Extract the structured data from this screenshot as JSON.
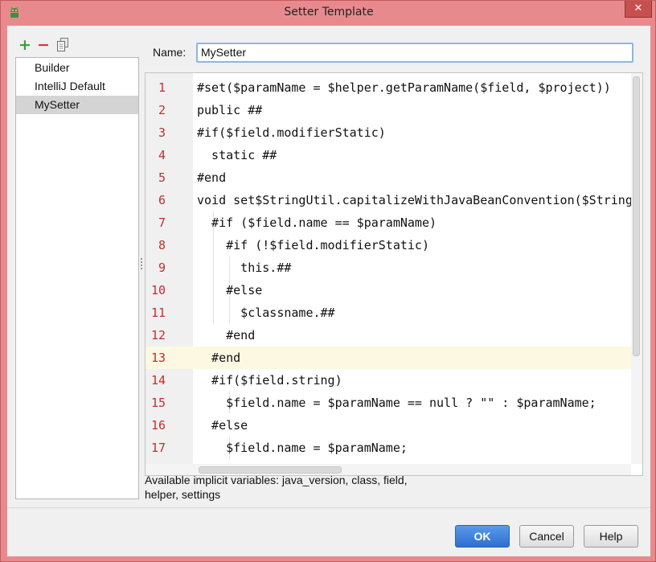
{
  "window": {
    "title": "Setter Template",
    "close_glyph": "✕"
  },
  "toolbar": {
    "add_icon": "plus-icon",
    "remove_icon": "minus-icon",
    "copy_icon": "copy-icon",
    "add_glyph": "+",
    "remove_glyph": "−"
  },
  "templates": {
    "items": [
      {
        "label": "Builder"
      },
      {
        "label": "IntelliJ Default"
      },
      {
        "label": "MySetter"
      }
    ],
    "selected": "MySetter"
  },
  "name_field": {
    "label": "Name:",
    "value": "MySetter"
  },
  "editor": {
    "current_line": 13,
    "lines": [
      {
        "num": "1",
        "text": "#set($paramName = $helper.getParamName($field, $project))"
      },
      {
        "num": "2",
        "text": "public ##"
      },
      {
        "num": "3",
        "text": "#if($field.modifierStatic)"
      },
      {
        "num": "4",
        "text": "  static ##"
      },
      {
        "num": "5",
        "text": "#end"
      },
      {
        "num": "6",
        "text": "void set$StringUtil.capitalizeWithJavaBeanConvention($StringUtil.sanitizeJavaIdentifier($helper.getPropertyName($field, $project)))($field.type $paramName) {"
      },
      {
        "num": "7",
        "text": "  #if ($field.name == $paramName)"
      },
      {
        "num": "8",
        "text": "    #if (!$field.modifierStatic)"
      },
      {
        "num": "9",
        "text": "      this.##"
      },
      {
        "num": "10",
        "text": "    #else"
      },
      {
        "num": "11",
        "text": "      $classname.##"
      },
      {
        "num": "12",
        "text": "    #end"
      },
      {
        "num": "13",
        "text": "  #end"
      },
      {
        "num": "14",
        "text": "  #if($field.string)"
      },
      {
        "num": "15",
        "text": "    $field.name = $paramName == null ? \"\" : $paramName;"
      },
      {
        "num": "16",
        "text": "  #else"
      },
      {
        "num": "17",
        "text": "    $field.name = $paramName;"
      }
    ]
  },
  "footer": {
    "vars_text": "Available implicit variables: java_version, class, field, helper, settings",
    "ok_label": "OK",
    "cancel_label": "Cancel",
    "help_label": "Help"
  },
  "colors": {
    "title_bar": "#e88a8d",
    "line_numbers": "#c22f2f",
    "current_line": "#fdf8e2",
    "ok_button": "#3b7fd8",
    "selection": "#d4d4d4"
  }
}
